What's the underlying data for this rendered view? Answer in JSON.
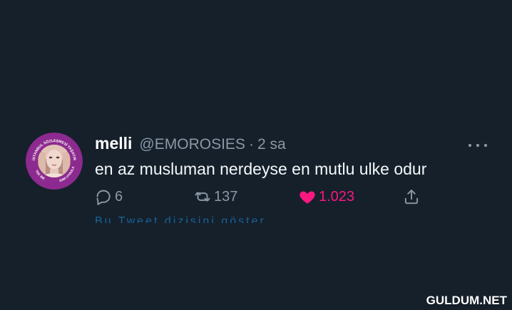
{
  "colors": {
    "background": "#15202b",
    "secondary_text": "#8b98a5",
    "like_pink": "#f91880",
    "link_blue": "#1d9bf0",
    "avatar_ring": "#8d2a8f"
  },
  "tweet": {
    "author_name": "melli",
    "author_handle": "@EMOROSIES",
    "separator": "·",
    "time_ago": "2 sa",
    "text": "en az musluman nerdeyse en mutlu ulke odur",
    "more_icon": "more-horizontal-icon",
    "actions": {
      "reply": {
        "icon": "reply-icon",
        "count": "6"
      },
      "retweet": {
        "icon": "retweet-icon",
        "count": "137"
      },
      "like": {
        "icon": "heart-icon",
        "count": "1.023"
      },
      "share": {
        "icon": "share-icon"
      }
    },
    "avatar": {
      "icon": "profile-avatar-icon",
      "ring_top_text": "İSTANBUL SÖZLEŞMESİ YAŞATIR",
      "ring_left_text": "TEK İDE",
      "ring_right_text": "6284 UYGULA"
    },
    "thread_link_text": "Bu Tweet dizisini göster"
  },
  "watermark": {
    "text": "GULDUM.NET"
  }
}
